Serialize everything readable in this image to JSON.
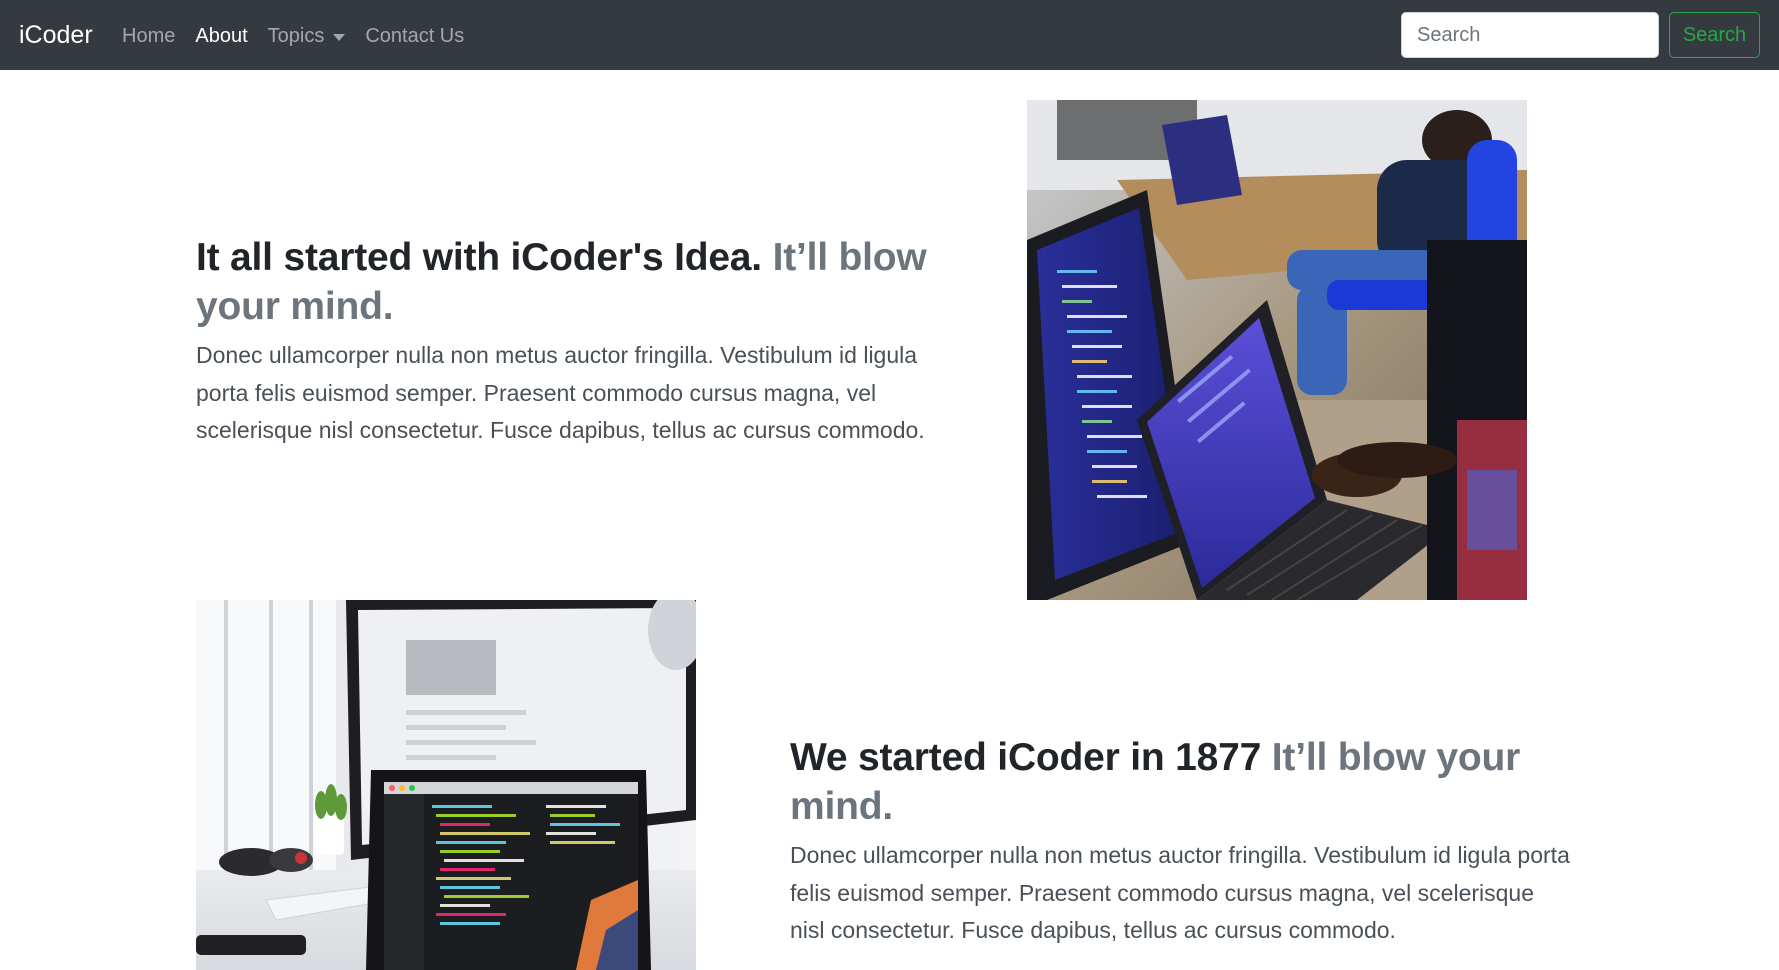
{
  "navbar": {
    "brand": "iCoder",
    "links": [
      {
        "label": "Home",
        "active": false
      },
      {
        "label": "About",
        "active": true
      },
      {
        "label": "Topics",
        "active": false,
        "dropdown": true
      },
      {
        "label": "Contact Us",
        "active": false
      }
    ],
    "search": {
      "placeholder": "Search",
      "value": ""
    },
    "search_button": "Search",
    "colors": {
      "background": "#343a40",
      "search_button": "#28a745"
    }
  },
  "featurettes": [
    {
      "heading": "It all started with iCoder's Idea.",
      "heading_muted": "It’ll blow your mind.",
      "lead": "Donec ullamcorper nulla non metus auctor fringilla. Vestibulum id ligula porta felis euismod semper. Praesent commodo cursus magna, vel scelerisque nisl consectetur. Fusce dapibus, tellus ac cursus commodo."
    },
    {
      "heading": "We started iCoder in 1877",
      "heading_muted": "It’ll blow your mind.",
      "lead": "Donec ullamcorper nulla non metus auctor fringilla. Vestibulum id ligula porta felis euismod semper. Praesent commodo cursus magna, vel scelerisque nisl consectetur. Fusce dapibus, tellus ac cursus commodo."
    }
  ]
}
